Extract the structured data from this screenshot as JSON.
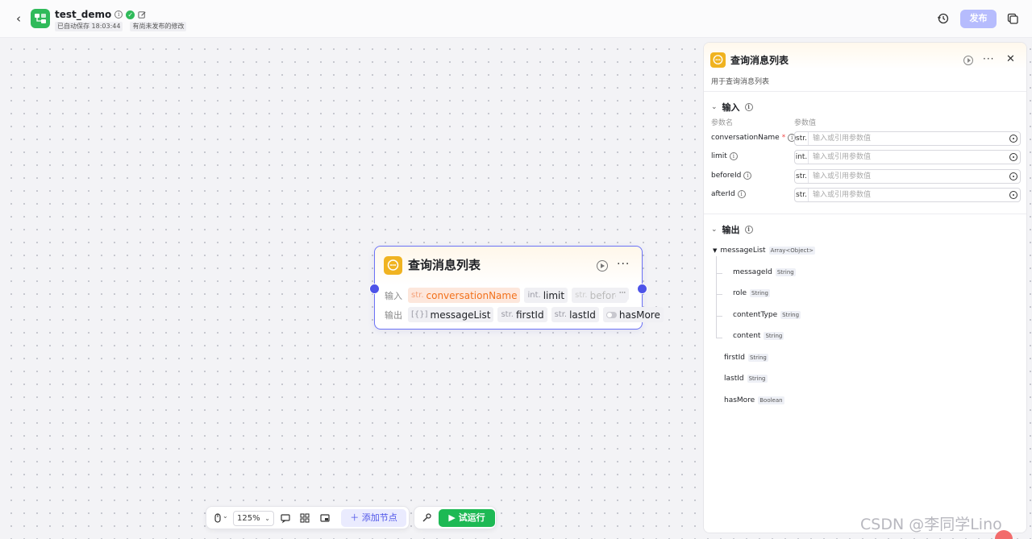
{
  "header": {
    "app_title": "test_demo",
    "autosave": "已自动保存 18:03:44",
    "unpublished": "有尚未发布的修改",
    "publish_label": "发布"
  },
  "colors": {
    "accent": "#4d53e8",
    "publish_disabled": "#b6bcfd",
    "node_icon": "#f0b321",
    "run_green": "#1db954",
    "required_chip": "#fde7dc"
  },
  "node": {
    "title": "查询消息列表",
    "input_label": "输入",
    "output_label": "输出",
    "inputs": [
      {
        "type": "str.",
        "name": "conversationName"
      },
      {
        "type": "int.",
        "name": "limit"
      },
      {
        "type": "str.",
        "name": "beforeI"
      }
    ],
    "more_label": "···",
    "outputs": [
      {
        "type": "[{}]",
        "name": "messageList"
      },
      {
        "type": "str.",
        "name": "firstId"
      },
      {
        "type": "str.",
        "name": "lastId"
      },
      {
        "type": "",
        "name": "hasMore"
      }
    ]
  },
  "toolbar": {
    "zoom": "125%",
    "add_node": "添加节点",
    "trial_run": "试运行"
  },
  "panel": {
    "title": "查询消息列表",
    "description": "用于查询消息列表",
    "input_section": "输入",
    "col_param_name": "参数名",
    "col_param_value": "参数值",
    "params": [
      {
        "name": "conversationName",
        "required": "*",
        "type": "str.",
        "placeholder": "输入或引用参数值"
      },
      {
        "name": "limit",
        "required": "",
        "type": "int.",
        "placeholder": "输入或引用参数值"
      },
      {
        "name": "beforeId",
        "required": "",
        "type": "str.",
        "placeholder": "输入或引用参数值"
      },
      {
        "name": "afterId",
        "required": "",
        "type": "str.",
        "placeholder": "输入或引用参数值"
      }
    ],
    "output_section": "输出",
    "outputs": {
      "messageList": {
        "name": "messageList",
        "type": "Array<Object>"
      },
      "children": [
        {
          "name": "messageId",
          "type": "String"
        },
        {
          "name": "role",
          "type": "String"
        },
        {
          "name": "contentType",
          "type": "String"
        },
        {
          "name": "content",
          "type": "String"
        }
      ],
      "others": [
        {
          "name": "firstId",
          "type": "String"
        },
        {
          "name": "lastId",
          "type": "String"
        },
        {
          "name": "hasMore",
          "type": "Boolean"
        }
      ]
    }
  },
  "watermark": "CSDN @李同学Lino"
}
